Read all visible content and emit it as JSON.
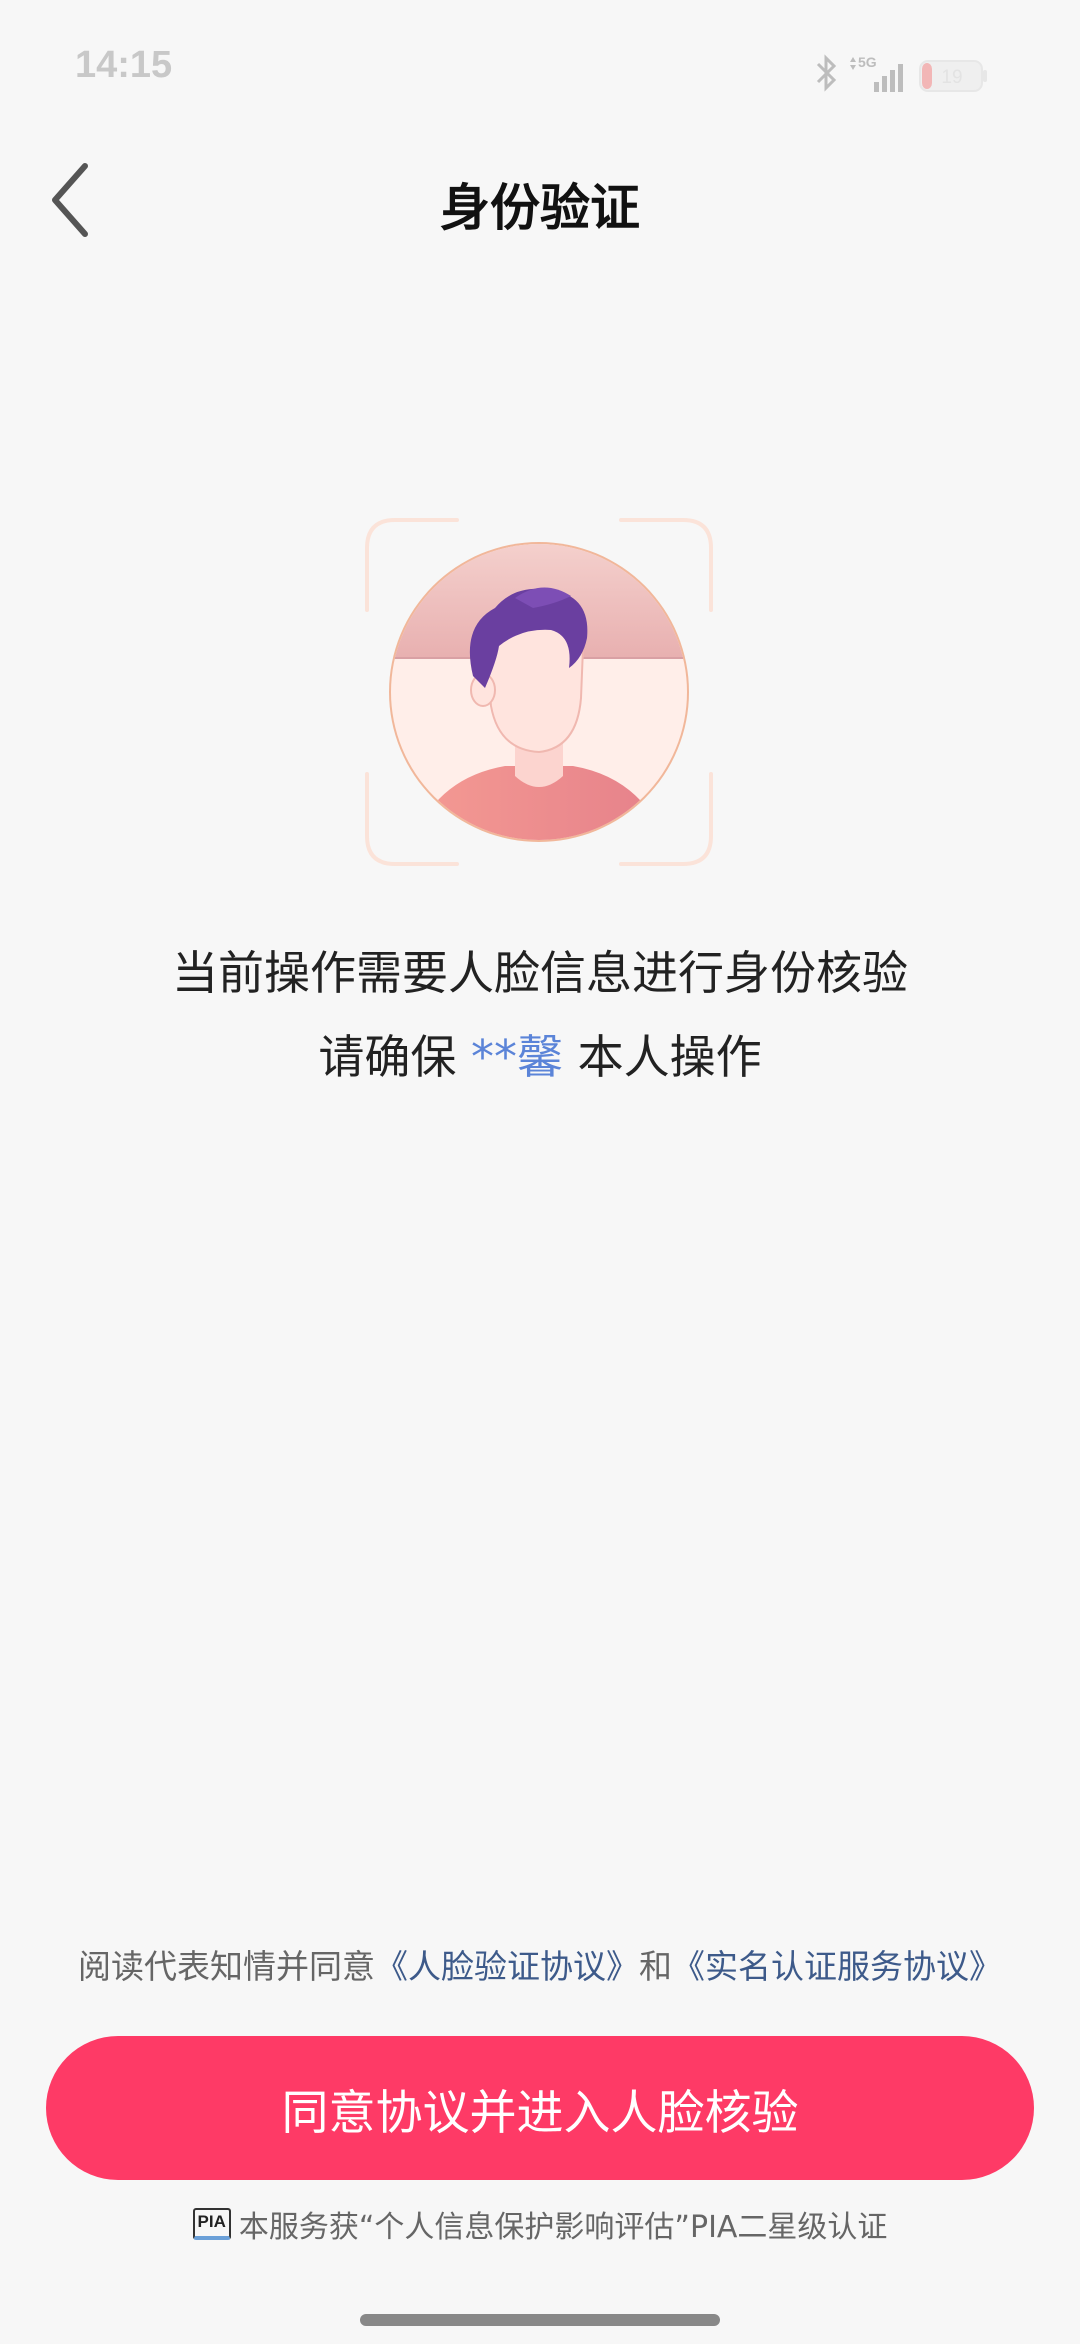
{
  "status_bar": {
    "time": "14:15",
    "network": "5G",
    "battery": "19"
  },
  "nav": {
    "title": "身份验证",
    "back_icon": "chevron-left-icon"
  },
  "illustration": {
    "icon": "face-avatar-icon"
  },
  "message": {
    "line1": "当前操作需要人脸信息进行身份核验",
    "line2_prefix": "请确保",
    "line2_name": "**馨",
    "line2_suffix": "本人操作"
  },
  "agreement": {
    "prefix": "阅读代表知情并同意",
    "link1": "《人脸验证协议》",
    "joiner": "和",
    "link2": "《实名认证服务协议》"
  },
  "button": {
    "label": "同意协议并进入人脸核验"
  },
  "footer": {
    "badge": "PIA",
    "text": "本服务获“个人信息保护影响评估”PIA二星级认证"
  },
  "colors": {
    "accent": "#fe3a66",
    "link": "#3d5a8a",
    "name_highlight": "#5b84d8"
  }
}
